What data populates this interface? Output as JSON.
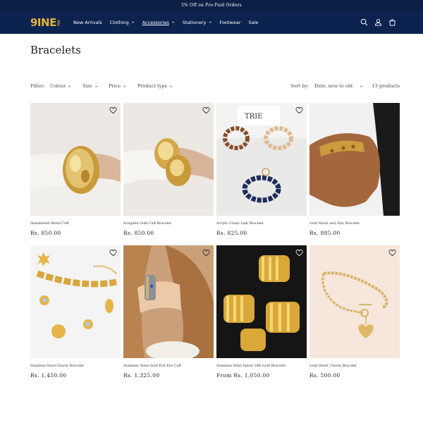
{
  "announcement": "5% Off on Pre-Paid Orders",
  "brand": {
    "logo_main": "9INE",
    "logo_sub": "TO5"
  },
  "nav": [
    {
      "label": "New Arrivals",
      "dropdown": false,
      "active": false
    },
    {
      "label": "Clothing",
      "dropdown": true,
      "active": false
    },
    {
      "label": "Accessories",
      "dropdown": true,
      "active": true
    },
    {
      "label": "Stationery",
      "dropdown": true,
      "active": false
    },
    {
      "label": "Footwear",
      "dropdown": false,
      "active": false
    },
    {
      "label": "Sale",
      "dropdown": false,
      "active": false
    }
  ],
  "header_icons": [
    "search-icon",
    "account-icon",
    "cart-icon"
  ],
  "page_title": "Bracelets",
  "filters": {
    "label": "Filter:",
    "items": [
      "Colour",
      "Size",
      "Price",
      "Product type"
    ],
    "sort_label": "Sort by:",
    "sort_value": "Date, new to old",
    "count": "13 products"
  },
  "products": [
    {
      "title": "Hammered Metal Cuff",
      "price": "Rs. 850.00"
    },
    {
      "title": "Sculpted Gold Cuff Bracelet",
      "price": "Rs. 850.00"
    },
    {
      "title": "Acrylic Chain Link Bracelet",
      "price": "Rs. 825.00"
    },
    {
      "title": "Gold Moon and Star Bracelet",
      "price": "Rs. 885.00"
    },
    {
      "title": "Stainless Steel Charm Bracelet",
      "price": "Rs. 1,450.00"
    },
    {
      "title": "Stainless Steel Gold Evil Eye Cuff",
      "price": "Rs. 1,325.00"
    },
    {
      "title": "Stainless Steel Spiral 18K Gold Bracelet",
      "price": "From Rs. 1,050.00"
    },
    {
      "title": "Gold Heart Charm Bracelet",
      "price": "Rs. 500.00"
    }
  ],
  "colors": {
    "header_bg": "#0c2350",
    "announcement_bg": "#0c1f45",
    "logo_gold": "#e2b23c"
  }
}
